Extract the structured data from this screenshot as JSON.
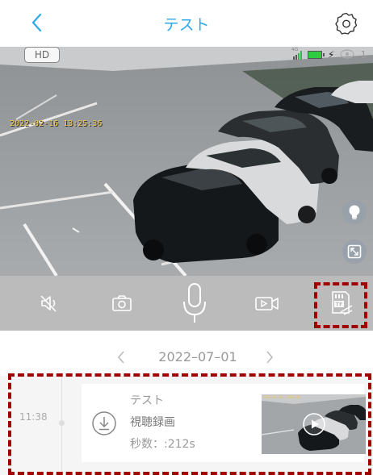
{
  "header": {
    "title": "テスト",
    "back_icon": "chevron-left-icon",
    "settings_icon": "gear-icon"
  },
  "camera": {
    "quality_label": "HD",
    "timestamp": "2022-02-16 13:25:36",
    "network_label": "4G",
    "viewer_count": "1",
    "light_icon": "bulb-icon",
    "fullscreen_icon": "fullscreen-icon"
  },
  "controls": {
    "items": [
      {
        "icon": "mute-speaker-icon"
      },
      {
        "icon": "camera-snapshot-icon"
      },
      {
        "icon": "microphone-icon"
      },
      {
        "icon": "video-record-icon"
      },
      {
        "icon": "tf-card-playback-icon"
      }
    ]
  },
  "date_nav": {
    "date": "2022–07–01",
    "prev_icon": "chevron-left-icon",
    "next_icon": "chevron-right-icon"
  },
  "records": [
    {
      "time": "11:38",
      "title": "テスト",
      "type": "視聴録画",
      "duration": "秒数：:212s",
      "timestamp_overlay": "2022-02-16 13:25:36"
    }
  ],
  "colors": {
    "accent": "#2fa8e8",
    "annotation": "#a00000",
    "control_bar": "#bbbbbb"
  }
}
